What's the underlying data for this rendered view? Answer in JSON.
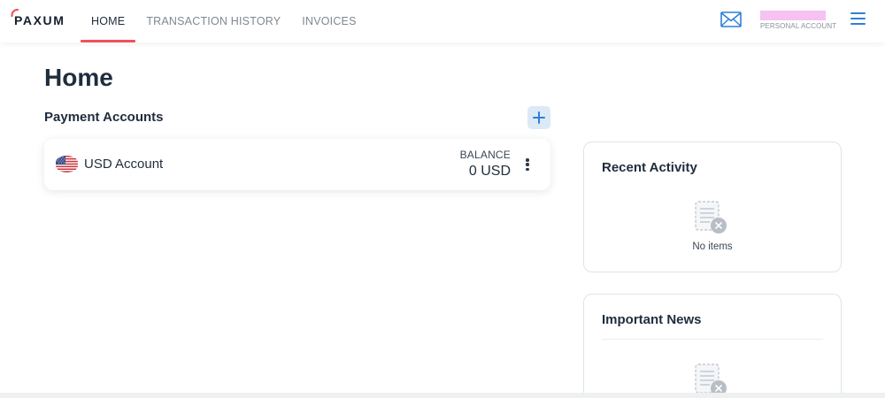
{
  "brand": {
    "logo_text": "PAXUM"
  },
  "nav": {
    "items": [
      {
        "label": "HOME",
        "active": true
      },
      {
        "label": "TRANSACTION HISTORY",
        "active": false
      },
      {
        "label": "INVOICES",
        "active": false
      }
    ]
  },
  "header": {
    "account_type": "PERSONAL ACCOUNT",
    "mail_icon": "mail-icon",
    "menu_icon": "hamburger-menu-icon"
  },
  "main": {
    "title": "Home",
    "payment_accounts": {
      "title": "Payment Accounts",
      "add_icon": "plus-icon",
      "accounts": [
        {
          "name": "USD Account",
          "flag": "us-flag-icon",
          "balance_label": "BALANCE",
          "balance": "0 USD"
        }
      ]
    }
  },
  "sidebar": {
    "recent_activity": {
      "title": "Recent Activity",
      "empty_text": "No items"
    },
    "important_news": {
      "title": "Important News"
    }
  },
  "colors": {
    "accent": "#2f7fd6",
    "active_tab_underline": "#f0525a",
    "text_primary": "#1f2d3d",
    "text_muted": "#7f8893"
  }
}
